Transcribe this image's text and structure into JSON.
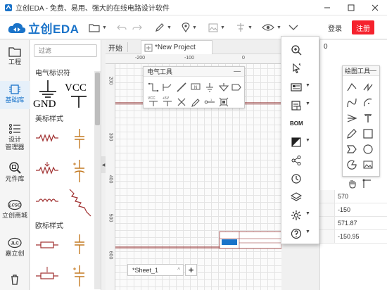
{
  "window": {
    "title": "立创EDA - 免费、易用、强大的在线电路设计软件"
  },
  "brand": {
    "logo_text": "立创EDA",
    "accent": "#1a73c9"
  },
  "header": {
    "login": "登录",
    "register": "注册",
    "register_color": "#f5222d"
  },
  "toolbar_icons": [
    "folder-icon",
    "undo-icon",
    "redo-icon",
    "pencil-icon",
    "place-icon",
    "image-icon",
    "align-icon",
    "view-icon",
    "more-icon"
  ],
  "left_nav": [
    {
      "label": "工程",
      "icon": "folder-icon"
    },
    {
      "label": "基础库",
      "icon": "chip-icon"
    },
    {
      "label": "设计\n管理器",
      "icon": "list-icon"
    },
    {
      "label": "元件库",
      "icon": "search-icon"
    },
    {
      "label": "立创商城",
      "icon": "lcsc-icon"
    },
    {
      "label": "嘉立创",
      "icon": "jlc-icon"
    }
  ],
  "library": {
    "filter_placeholder": "过滤",
    "sections": [
      "电气标识符",
      "美标样式",
      "欧标样式"
    ],
    "gnd_label": "GND",
    "vcc_label": "VCC"
  },
  "tabs": {
    "start": "开始",
    "project": "*New Project"
  },
  "ruler": {
    "top_marks": [
      "-200",
      "-100",
      "0"
    ],
    "left_marks": [
      "200",
      "300",
      "400",
      "500",
      "600"
    ]
  },
  "electrical_tools": {
    "title": "电气工具",
    "tools": [
      "wire",
      "bus-entry",
      "bus",
      "net-label",
      "gnd",
      "gnd-alt",
      "net-port",
      "vcc",
      "plus5v",
      "no-connect",
      "probe",
      "pin",
      "group"
    ],
    "vcc_text": "VCC",
    "plus5v_text": "+5V"
  },
  "vertical_menu": {
    "items": [
      "zoom-in-icon",
      "cursor-icon",
      "layout-icon",
      "document-icon",
      "BOM",
      "theme-icon",
      "share-icon",
      "history-icon",
      "layers-icon",
      "settings-icon",
      "help-icon"
    ],
    "bom_label": "BOM"
  },
  "drawing_tools": {
    "title": "绘图工具"
  },
  "properties": {
    "values": [
      "570",
      "-150",
      "571.87",
      "-150.95"
    ]
  },
  "sheet": {
    "name": "*Sheet_1",
    "add": "+"
  }
}
